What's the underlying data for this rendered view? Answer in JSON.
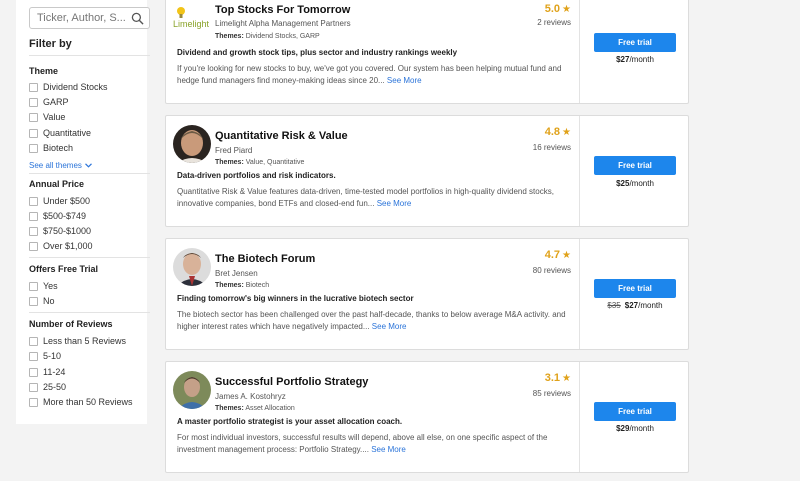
{
  "search": {
    "placeholder": "Ticker, Author, S..."
  },
  "sidebar": {
    "filter_by": "Filter by",
    "theme": {
      "title": "Theme",
      "options": [
        "Dividend Stocks",
        "GARP",
        "Value",
        "Quantitative",
        "Biotech"
      ],
      "see_all": "See all themes"
    },
    "annual_price": {
      "title": "Annual Price",
      "options": [
        "Under $500",
        "$500-$749",
        "$750-$1000",
        "Over $1,000"
      ]
    },
    "free_trial": {
      "title": "Offers Free Trial",
      "options": [
        "Yes",
        "No"
      ]
    },
    "reviews": {
      "title": "Number of Reviews",
      "options": [
        "Less than 5 Reviews",
        "5-10",
        "11-24",
        "25-50",
        "More than 50 Reviews"
      ]
    }
  },
  "cards": [
    {
      "title": "Top Stocks For Tomorrow",
      "author": "Limelight Alpha Management Partners",
      "themes_label": "Themes:",
      "themes": "Dividend Stocks, GARP",
      "rating": "5.0",
      "reviews": "2 reviews",
      "headline": "Dividend and growth stock tips, plus sector and industry rankings weekly",
      "description": "If you're looking for new stocks to buy, we've got you covered. Our system has been helping mutual fund and hedge fund managers find money-making ideas since 20...",
      "see_more": "See More",
      "button": "Free trial",
      "price": "$27",
      "per": "/month",
      "old_price": "",
      "logo_text": "Limelight"
    },
    {
      "title": "Quantitative Risk & Value",
      "author": "Fred Piard",
      "themes_label": "Themes:",
      "themes": "Value, Quantitative",
      "rating": "4.8",
      "reviews": "16 reviews",
      "headline": "Data-driven portfolios and risk indicators.",
      "description": "Quantitative Risk & Value features data-driven, time-tested model portfolios in high-quality dividend stocks, innovative companies, bond ETFs and closed-end fun...",
      "see_more": "See More",
      "button": "Free trial",
      "price": "$25",
      "per": "/month",
      "old_price": ""
    },
    {
      "title": "The Biotech Forum",
      "author": "Bret Jensen",
      "themes_label": "Themes:",
      "themes": "Biotech",
      "rating": "4.7",
      "reviews": "80 reviews",
      "headline": "Finding tomorrow's big winners in the lucrative biotech sector",
      "description": "The biotech sector has been challenged over the past half-decade, thanks to below average M&A activity. and higher interest rates which have negatively impacted...",
      "see_more": "See More",
      "button": "Free trial",
      "price": "$27",
      "per": "/month",
      "old_price": "$35"
    },
    {
      "title": "Successful Portfolio Strategy",
      "author": "James A. Kostohryz",
      "themes_label": "Themes:",
      "themes": "Asset Allocation",
      "rating": "3.1",
      "reviews": "85 reviews",
      "headline": "A master portfolio strategist is your asset allocation coach.",
      "description": "For most individual investors, successful results will depend, above all else, on one specific aspect of the investment management process: Portfolio Strategy....",
      "see_more": "See More",
      "button": "Free trial",
      "price": "$29",
      "per": "/month",
      "old_price": ""
    }
  ],
  "colors": {
    "accent": "#1d86ec",
    "star": "#e0a21a",
    "link": "#2b74d9"
  }
}
